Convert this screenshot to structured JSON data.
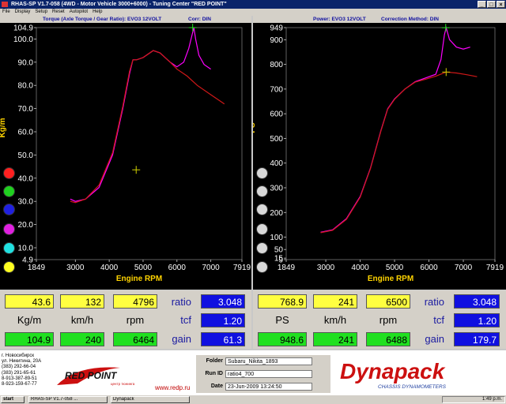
{
  "window": {
    "title": "RHAS-SP V1.7-058  (4WD - Motor Vehicle 3000+6000) - Tuning Center \"RED POINT\"",
    "minimize": "_",
    "maximize": "□",
    "close": "×"
  },
  "menu": [
    "File",
    "Display",
    "Setup",
    "Reset",
    "Autopilot",
    "Help"
  ],
  "left_chart": {
    "header_left": "Torque (Axle Torque / Gear Ratio): EVO3 12VOLT",
    "header_right": "Corr: DIN",
    "ylabel": "Kg/m",
    "xlabel": "Engine RPM",
    "y_max_label": "104.9",
    "y_min_label": "4.9",
    "y_ticks": [
      "100.0",
      "90.0",
      "80.0",
      "70.0",
      "60.0",
      "50.0",
      "40.0",
      "30.0",
      "20.0",
      "10.0"
    ],
    "x_min_label": "1849",
    "x_max_label": "7919",
    "x_ticks": [
      "3000",
      "4000",
      "5000",
      "6000",
      "7000"
    ]
  },
  "right_chart": {
    "header_left": "Power: EVO3 12VOLT",
    "header_right": "Correction Method: DIN",
    "ylabel": "PS",
    "xlabel": "Engine RPM",
    "y_max_label": "949",
    "y_min_label": "9",
    "y_ticks": [
      "900",
      "800",
      "700",
      "600",
      "500",
      "400",
      "300",
      "200",
      "100",
      "50",
      "15"
    ],
    "x_min_label": "1849",
    "x_max_label": "7919",
    "x_ticks": [
      "3000",
      "4000",
      "5000",
      "6000",
      "7000"
    ]
  },
  "chart_data": [
    {
      "type": "line",
      "ylabel": "Kg/m",
      "xlabel": "Engine RPM",
      "xlim": [
        1849,
        7919
      ],
      "ylim": [
        4.9,
        104.9
      ],
      "series": [
        {
          "color": "#ff00ff",
          "x": [
            2850,
            3000,
            3300,
            3700,
            4100,
            4400,
            4600,
            4700,
            4800,
            5000,
            5300,
            5500,
            5800,
            6000,
            6200,
            6350,
            6450,
            6500,
            6550,
            6650,
            6800,
            7000
          ],
          "y": [
            31,
            30,
            31,
            36,
            50,
            70,
            85,
            91,
            91,
            92,
            95,
            94,
            90,
            88,
            90,
            96,
            102,
            104.9,
            100,
            93,
            89,
            87
          ]
        },
        {
          "color": "#d01818",
          "x": [
            2850,
            3000,
            3300,
            3700,
            4100,
            4400,
            4600,
            4700,
            4800,
            5000,
            5300,
            5500,
            5800,
            6000,
            6300,
            6600,
            7000,
            7400
          ],
          "y": [
            30,
            29.5,
            31,
            37,
            51,
            71,
            86,
            91,
            91,
            92,
            95,
            94,
            90,
            87,
            84,
            80,
            76,
            72
          ]
        }
      ],
      "markers": [
        {
          "x": 4796,
          "y": 43.6,
          "color": "#d0d000"
        },
        {
          "x": 6464,
          "y": 104.9,
          "color": "#20e020"
        }
      ]
    },
    {
      "type": "line",
      "ylabel": "PS",
      "xlabel": "Engine RPM",
      "xlim": [
        1849,
        7919
      ],
      "ylim": [
        9,
        949
      ],
      "series": [
        {
          "color": "#ff00ff",
          "x": [
            2850,
            3200,
            3600,
            4000,
            4300,
            4600,
            4800,
            5000,
            5300,
            5600,
            5900,
            6200,
            6350,
            6450,
            6500,
            6600,
            6800,
            7000,
            7200
          ],
          "y": [
            120,
            130,
            175,
            265,
            380,
            530,
            620,
            660,
            700,
            730,
            745,
            760,
            820,
            920,
            948.6,
            900,
            870,
            862,
            870
          ]
        },
        {
          "color": "#d01818",
          "x": [
            2850,
            3200,
            3600,
            4000,
            4300,
            4600,
            4800,
            5000,
            5300,
            5600,
            5900,
            6200,
            6500,
            6800,
            7100,
            7400
          ],
          "y": [
            118,
            128,
            172,
            262,
            378,
            528,
            618,
            658,
            700,
            728,
            740,
            752,
            768.9,
            765,
            758,
            750
          ]
        }
      ],
      "markers": [
        {
          "x": 6500,
          "y": 768.9,
          "color": "#d0d000"
        },
        {
          "x": 6488,
          "y": 948.6,
          "color": "#20e020"
        }
      ]
    }
  ],
  "left_panel": {
    "row1": [
      "43.6",
      "132",
      "4796"
    ],
    "units": [
      "Kg/m",
      "km/h",
      "rpm"
    ],
    "row3": [
      "104.9",
      "240",
      "6464"
    ],
    "labels": [
      "ratio",
      "tcf",
      "gain"
    ],
    "stats": [
      "3.048",
      "1.20",
      "61.3"
    ]
  },
  "right_panel": {
    "row1": [
      "768.9",
      "241",
      "6500"
    ],
    "units": [
      "PS",
      "km/h",
      "rpm"
    ],
    "row3": [
      "948.6",
      "241",
      "6488"
    ],
    "labels": [
      "ratio",
      "tcf",
      "gain"
    ],
    "stats": [
      "3.048",
      "1.20",
      "179.7"
    ]
  },
  "left_dots": [
    "#ff2020",
    "#20d020",
    "#2020e0",
    "#e020e0",
    "#20e0e0",
    "#ffff20"
  ],
  "footer": {
    "address": [
      "г. Новосибирск",
      "ул. Никитина, 20А",
      "(383) 292-66-04",
      "(383) 291-65-61",
      "8-913-387-89-51",
      "8-923-159-67-77"
    ],
    "logo_text": "RED POINT",
    "logo_sub": "центр тюнинга",
    "site": "www.redp.ru",
    "folder_label": "Folder",
    "folder_value": "Subaru_Nikita_1893",
    "run_label": "Run ID",
    "run_value": "ratio4_700",
    "date_label": "Date",
    "date_value": "23-Jun-2009   13:24:50",
    "dyna_logo": "Dynapack",
    "dyna_sub": "CHASSIS DYNAMOMETERS"
  },
  "taskbar": {
    "start": "start",
    "items": [
      "RHAS-SP V1.7-058 ...",
      "Dynapack"
    ],
    "clock": "1:49 p.m."
  }
}
